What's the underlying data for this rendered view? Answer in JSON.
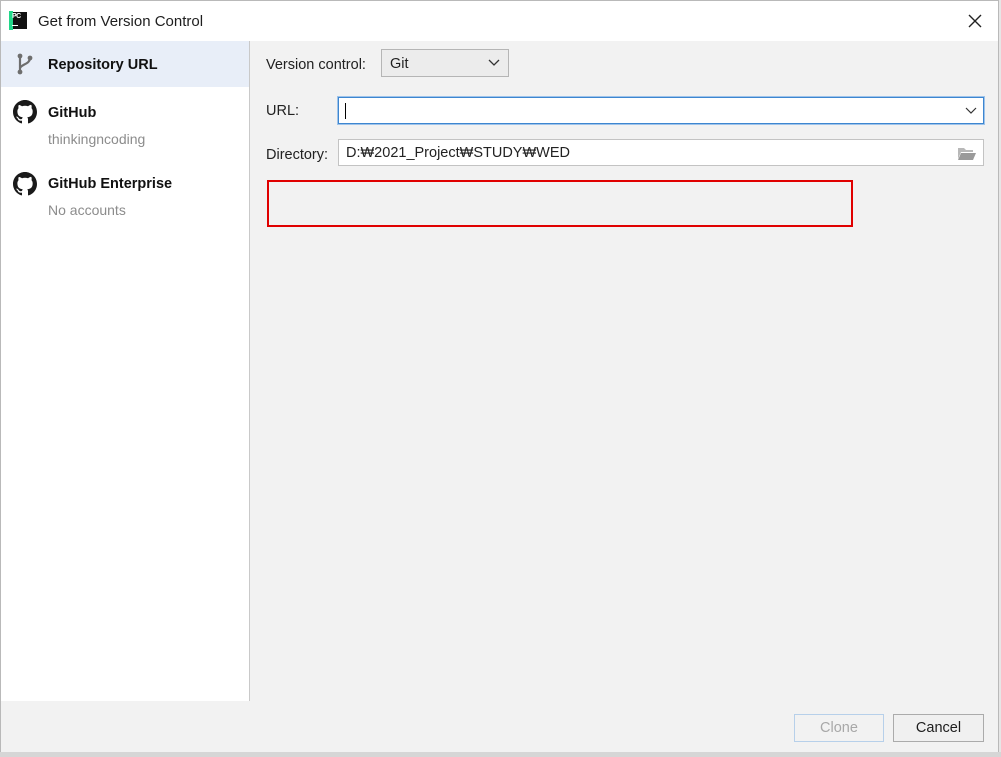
{
  "window": {
    "title": "Get from Version Control",
    "app_icon": "pycharm-icon",
    "close_icon": "close-icon"
  },
  "sidebar": {
    "items": [
      {
        "label": "Repository URL",
        "sub": "",
        "icon": "branch-icon",
        "active": true
      },
      {
        "label": "GitHub",
        "sub": "thinkingncoding",
        "icon": "github-icon",
        "active": false
      },
      {
        "label": "GitHub Enterprise",
        "sub": "No accounts",
        "icon": "github-icon",
        "active": false
      }
    ]
  },
  "form": {
    "version_control_label": "Version control:",
    "version_control_value": "Git",
    "url_label": "URL:",
    "url_value": "",
    "directory_label": "Directory:",
    "directory_value": "D:₩2021_Project₩STUDY₩WED"
  },
  "buttons": {
    "clone": "Clone",
    "cancel": "Cancel"
  },
  "colors": {
    "accent": "#3d86d0",
    "highlight": "#e00000",
    "sidebar_active": "#e8eef8"
  }
}
